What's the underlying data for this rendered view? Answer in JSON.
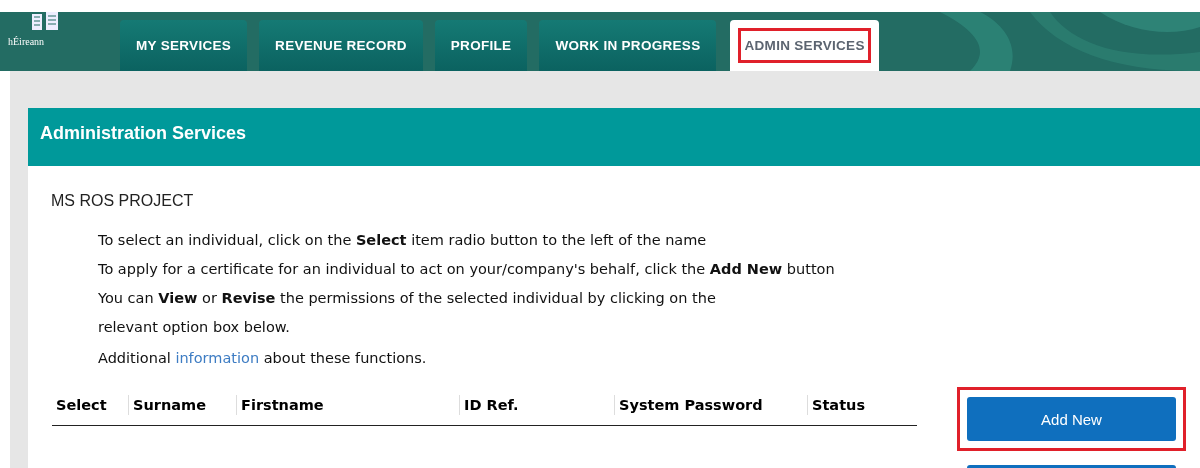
{
  "header": {
    "logo_text": "hÉireann"
  },
  "tabs": [
    {
      "label": "MY SERVICES",
      "selected": false,
      "highlighted": false
    },
    {
      "label": "REVENUE RECORD",
      "selected": false,
      "highlighted": false
    },
    {
      "label": "PROFILE",
      "selected": false,
      "highlighted": false
    },
    {
      "label": "WORK IN PROGRESS",
      "selected": false,
      "highlighted": false
    },
    {
      "label": "ADMIN SERVICES",
      "selected": true,
      "highlighted": true
    }
  ],
  "panel": {
    "title": "Administration Services",
    "organisation": "MS ROS PROJECT",
    "instructions": [
      "To select an individual, click on the **Select** item radio button to the left of the name",
      "To apply for a certificate for an individual to act on your/company's behalf, click the **Add New** button",
      "You can **View** or **Revise** the permissions of the selected individual by clicking on the relevant option box below."
    ],
    "info": {
      "before": "Additional ",
      "link": "information",
      "after": " about these functions."
    }
  },
  "table": {
    "columns": [
      "Select",
      "Surname",
      "Firstname",
      "ID Ref.",
      "System Password",
      "Status"
    ]
  },
  "buttons": [
    {
      "label": "Add New",
      "highlighted": true
    },
    {
      "highlighted": false
    }
  ]
}
